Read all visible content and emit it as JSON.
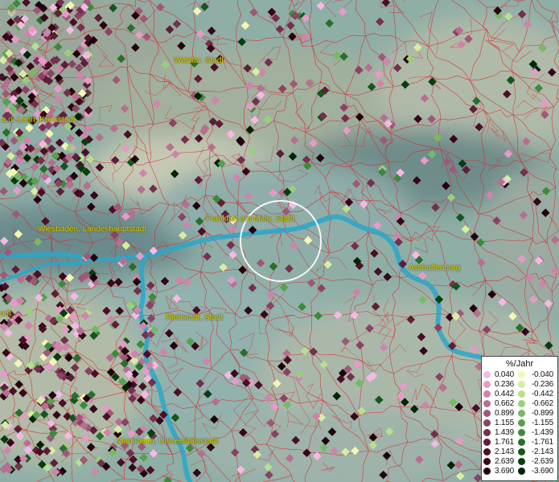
{
  "legend": {
    "title": "%/Jahr",
    "positive": [
      {
        "label": "0.040",
        "color": "#f6b8e4"
      },
      {
        "label": "0.236",
        "color": "#e79ac8"
      },
      {
        "label": "0.442",
        "color": "#d084ab"
      },
      {
        "label": "0.662",
        "color": "#b76f90"
      },
      {
        "label": "0.899",
        "color": "#a05877"
      },
      {
        "label": "1.155",
        "color": "#8a4362"
      },
      {
        "label": "1.439",
        "color": "#74304d"
      },
      {
        "label": "1.761",
        "color": "#5e1e38"
      },
      {
        "label": "2.143",
        "color": "#4a0f27"
      },
      {
        "label": "2.639",
        "color": "#360619"
      },
      {
        "label": "3.690",
        "color": "#22000c"
      }
    ],
    "negative": [
      {
        "label": "-0.040",
        "color": "#f3f7b6"
      },
      {
        "label": "-0.236",
        "color": "#d6eea0"
      },
      {
        "label": "-0.442",
        "color": "#b7df8e"
      },
      {
        "label": "-0.662",
        "color": "#99cf7c"
      },
      {
        "label": "-0.899",
        "color": "#78b963"
      },
      {
        "label": "-1.155",
        "color": "#58a14c"
      },
      {
        "label": "-1.439",
        "color": "#3e8a3c"
      },
      {
        "label": "-1.761",
        "color": "#26702b"
      },
      {
        "label": "-2.143",
        "color": "#14561c"
      },
      {
        "label": "-2.639",
        "color": "#083d0f"
      },
      {
        "label": "-3.690",
        "color": "#022405"
      }
    ]
  },
  "cities": [
    {
      "name": "Wetzlar, Stadt"
    },
    {
      "name": "a.d. Lahn, Kreisstadt"
    },
    {
      "name": "Wiesbaden, Landeshauptstadt"
    },
    {
      "name": "Frankfurt am Main, Stadt"
    },
    {
      "name": "Aschaffenburg"
    },
    {
      "name": "Riedstadt, Stadt"
    },
    {
      "name": "Mannheim, Universitätsstadt"
    },
    {
      "name": "adt"
    }
  ],
  "colors": {
    "river": "#2aa7c9",
    "boundaries": "#d8262b",
    "terrain": "#8fb0a8",
    "label": "#d8d000",
    "highlight_circle": "#ffffff"
  }
}
